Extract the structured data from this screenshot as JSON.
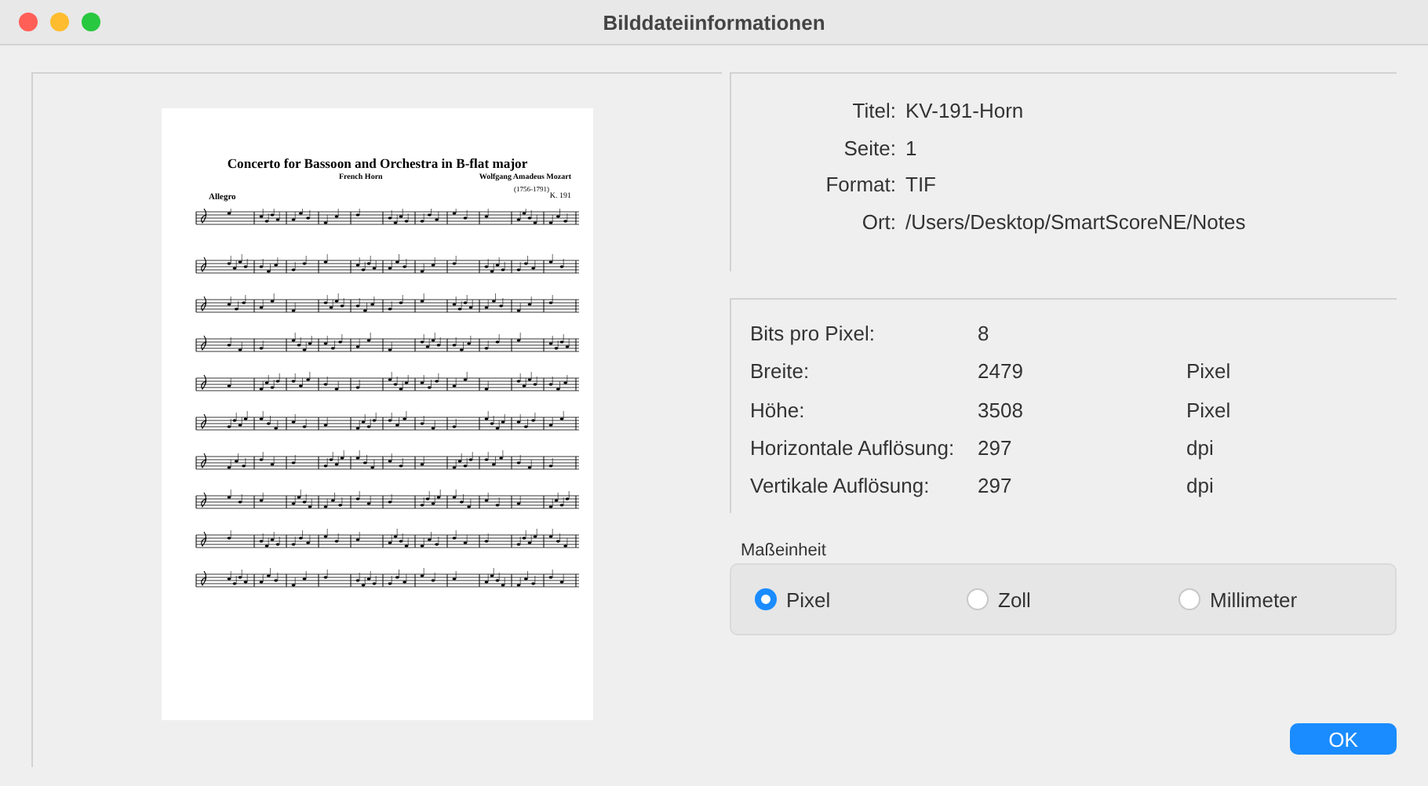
{
  "window": {
    "title": "Bilddateiinformationen"
  },
  "preview": {
    "title": "Concerto for Bassoon and Orchestra in B-flat major",
    "instrument": "French Horn",
    "composer": "Wolfgang Amadeus Mozart",
    "dates": "(1756-1791)",
    "catalog": "K. 191",
    "tempo": "Allegro"
  },
  "file_info": [
    {
      "label": "Titel:",
      "value": "KV-191-Horn"
    },
    {
      "label": "Seite:",
      "value": "1"
    },
    {
      "label": "Format:",
      "value": "TIF"
    },
    {
      "label": "Ort:",
      "value": "/Users/Desktop/SmartScoreNE/Notes"
    }
  ],
  "image_info": [
    {
      "label": "Bits pro Pixel:",
      "value": "8"
    },
    {
      "label": "Breite:",
      "value": "2479",
      "unit": "Pixel"
    },
    {
      "label": "Höhe:",
      "value": "3508",
      "unit": "Pixel"
    },
    {
      "label": "Horizontale Auflösung:",
      "value": "297",
      "unit": "dpi"
    },
    {
      "label": "Vertikale Auflösung:",
      "value": "297",
      "unit": "dpi"
    }
  ],
  "unit_group": {
    "title": "Maßeinheit",
    "options": [
      {
        "label": "Pixel",
        "selected": true
      },
      {
        "label": "Zoll",
        "selected": false
      },
      {
        "label": "Millimeter",
        "selected": false
      }
    ]
  },
  "buttons": [
    {
      "label": "OK"
    }
  ]
}
